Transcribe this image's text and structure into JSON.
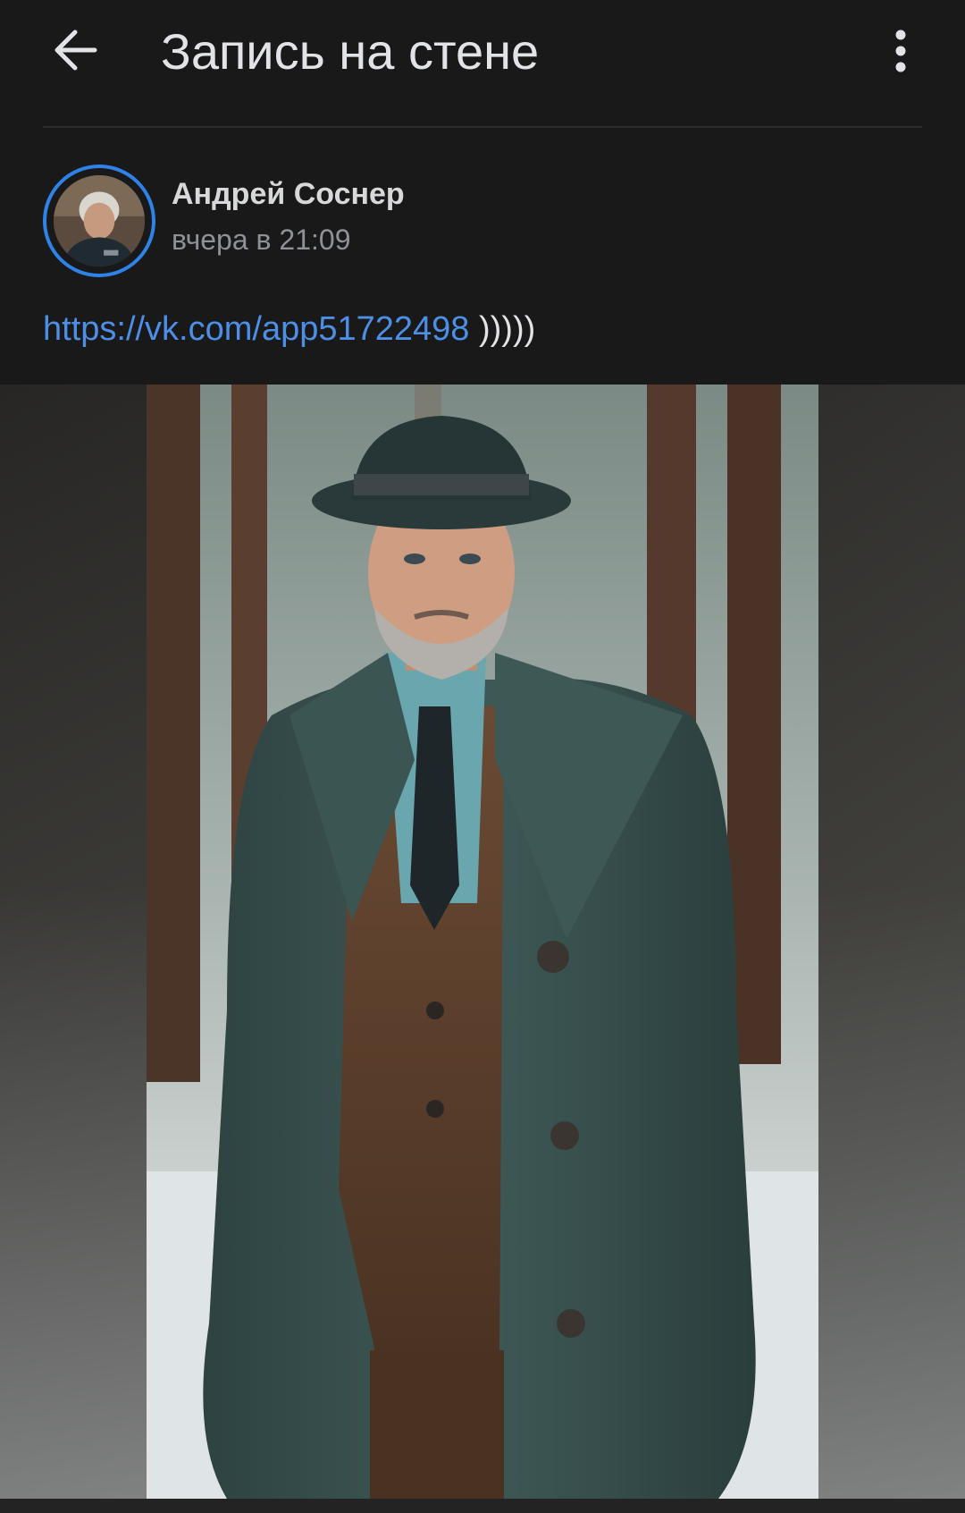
{
  "header": {
    "title": "Запись на стене",
    "back_icon": "arrow-left-icon",
    "more_icon": "more-vertical-icon"
  },
  "post": {
    "author": "Андрей Соснер",
    "time": "вчера в 21:09",
    "link": "https://vk.com/app51722498",
    "text_suffix": " )))))"
  },
  "colors": {
    "background": "#19191a",
    "accent": "#4d8fe6",
    "avatar_ring": "#2f82e6",
    "secondary_text": "#8e9196"
  },
  "photo": {
    "subject": "man-in-hat-and-coat-in-snowy-forest"
  }
}
